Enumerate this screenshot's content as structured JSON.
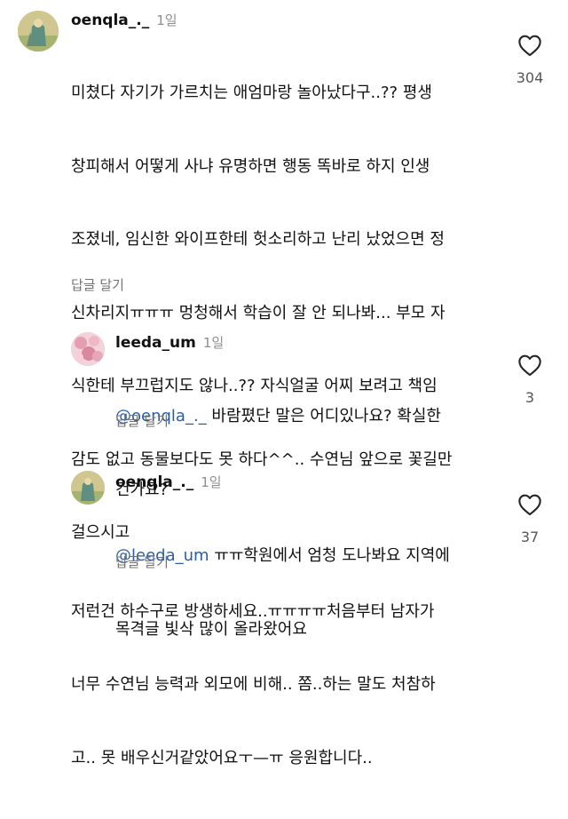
{
  "comments": [
    {
      "username": "oenqla_._",
      "time": "1일",
      "text_lines": [
        "미쳤다 자기가 가르치는 애엄마랑 놀아났다구..?? 평생",
        "창피해서 어떻게 사냐 유명하면 행동 똑바로 하지 인생",
        "조졌네, 임신한 와이프한테 헛소리하고 난리 났었으면 정",
        "신차리지ㅠㅠㅠ 멍청해서 학습이 잘 안 되나봐... 부모 자",
        "식한테 부끄럽지도 않나..?? 자식얼굴 어찌 보려고 책임",
        "감도 없고 동물보다도 못 하다^^.. 수연님 앞으로 꽃길만",
        "걸으시고",
        "저런건 하수구로 방생하세요..ㅠㅠㅠㅠ처음부터 남자가",
        "너무 수연님 능력과 외모에 비해.. 쫌..하는 말도 처참하",
        "고.. 못 배우신거같았어요ㅜ—ㅠ 응원합니다.."
      ],
      "reply_label": "답글 달기",
      "likes": "304"
    },
    {
      "username": "leeda_um",
      "time": "1일",
      "mention": "@oenqla_._",
      "text_line1": " 바람폈단 말은 어디있나요? 확실한",
      "text_line2": "건가요?",
      "reply_label": "답글 달기",
      "likes": "3"
    },
    {
      "username": "oenqla_._",
      "time": "1일",
      "mention": "@leeda_um",
      "text_line1": " ㅠㅠ학원에서 엄청 도나봐요 지역에",
      "text_line2": "목격글 빛삭 많이 올라왔어요",
      "reply_label": "답글 달기",
      "likes": "37"
    }
  ],
  "icons": {
    "like": "heart-outline-icon"
  },
  "colors": {
    "mention": "#2b5da6",
    "secondary": "#737373"
  }
}
